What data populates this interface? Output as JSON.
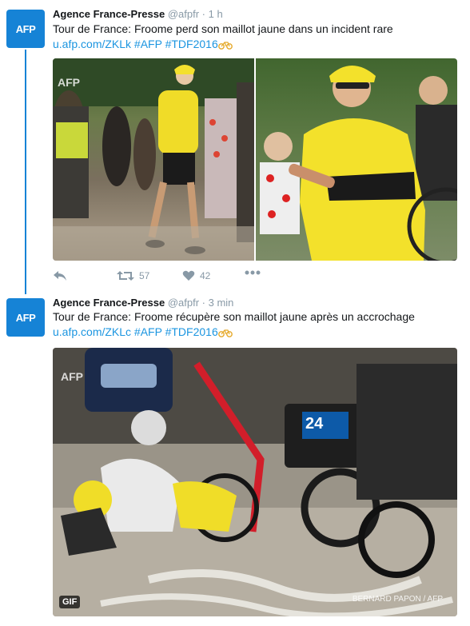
{
  "tweets": [
    {
      "avatar_text": "AFP",
      "name": "Agence France-Presse",
      "handle": "@afpfr",
      "dot": "·",
      "time": "1 h",
      "text": "Tour de France: Froome perd son maillot jaune dans un incident rare",
      "link_text": "u.afp.com/ZKLk #AFP #TDF2016",
      "watermark": "AFP",
      "actions": {
        "reply": "",
        "retweet_count": "57",
        "like_count": "42"
      }
    },
    {
      "avatar_text": "AFP",
      "name": "Agence France-Presse",
      "handle": "@afpfr",
      "dot": "·",
      "time": "3 min",
      "text": "Tour de France: Froome récupère son maillot jaune après un accrochage",
      "link_text": "u.afp.com/ZKLc #AFP #TDF2016",
      "watermark": "AFP",
      "gif_badge": "GIF",
      "photo_credit": "BERNARD PAPON / AFP",
      "tv_logo": "24"
    }
  ],
  "colors": {
    "brand": "#1683d6",
    "link": "#1b95e0",
    "muted": "#8899a6",
    "yellow": "#f2e22a"
  }
}
